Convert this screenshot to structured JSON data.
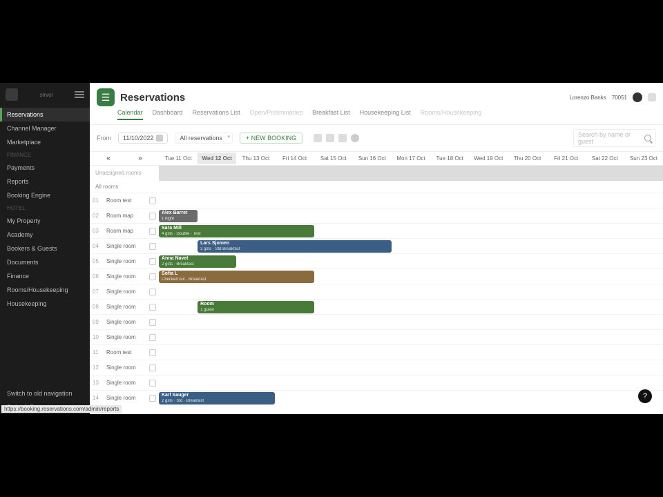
{
  "brand": "sirvoi",
  "sidebar": {
    "sections": [
      {
        "label": "",
        "items": [
          {
            "label": "Reservations",
            "active": true
          },
          {
            "label": "Channel Manager"
          },
          {
            "label": "Marketplace"
          }
        ]
      },
      {
        "label": "FINANCE",
        "items": [
          {
            "label": "Payments"
          },
          {
            "label": "Reports"
          },
          {
            "label": "Booking Engine"
          }
        ]
      },
      {
        "label": "HOTEL",
        "items": [
          {
            "label": "My Property"
          },
          {
            "label": "Academy"
          },
          {
            "label": "Bookers & Guests"
          },
          {
            "label": "Documents"
          },
          {
            "label": "Finance"
          },
          {
            "label": "Rooms/Housekeeping"
          },
          {
            "label": "Housekeeping"
          }
        ]
      }
    ],
    "footer": [
      {
        "label": "Switch to old navigation"
      },
      {
        "label": "Refer & Earn"
      }
    ]
  },
  "header": {
    "title": "Reservations",
    "account": "Lorenzo Banks",
    "account_id": "70051"
  },
  "tabs": [
    {
      "label": "Calendar",
      "active": true
    },
    {
      "label": "Dashboard"
    },
    {
      "label": "Reservations List"
    },
    {
      "label": "Open/Preliminaries",
      "muted": true
    },
    {
      "label": "Breakfast List"
    },
    {
      "label": "Housekeeping List"
    },
    {
      "label": "Rooms/Housekeeping",
      "muted": true
    }
  ],
  "toolbar": {
    "from_label": "From",
    "date": "11/10/2022",
    "filter": "All reservations",
    "new_btn": "+ NEW BOOKING",
    "search_placeholder": "Search by name or guest"
  },
  "calendar": {
    "dates": [
      "Tue 11 Oct",
      "Wed 12 Oct",
      "Thu 13 Oct",
      "Fri 14 Oct",
      "Sat 15 Oct",
      "Sun 16 Oct",
      "Mon 17 Oct",
      "Tue 18 Oct",
      "Wed 19 Oct",
      "Thu 20 Oct",
      "Fri 21 Oct",
      "Sat 22 Oct",
      "Sun 23 Oct"
    ],
    "today_index": 1,
    "unassigned_label": "Unassigned rooms",
    "allrooms_label": "All rooms",
    "rooms": [
      {
        "num": "01",
        "name": "Room test"
      },
      {
        "num": "02",
        "name": "Room map"
      },
      {
        "num": "03",
        "name": "Room map"
      },
      {
        "num": "04",
        "name": "Single room"
      },
      {
        "num": "05",
        "name": "Single room"
      },
      {
        "num": "06",
        "name": "Single room"
      },
      {
        "num": "07",
        "name": "Single room"
      },
      {
        "num": "08",
        "name": "Single room"
      },
      {
        "num": "09",
        "name": "Single room"
      },
      {
        "num": "10",
        "name": "Single room"
      },
      {
        "num": "11",
        "name": "Room test"
      },
      {
        "num": "12",
        "name": "Single room"
      },
      {
        "num": "13",
        "name": "Single room"
      },
      {
        "num": "14",
        "name": "Single room"
      }
    ],
    "bookings": [
      {
        "room": 1,
        "start": 0,
        "span": 1,
        "color": "c-grey",
        "title": "Alex Barret",
        "sub": "1 night"
      },
      {
        "room": 2,
        "start": 0,
        "span": 4,
        "color": "c-green",
        "title": "Sara Mill",
        "sub": "4 gsts · Double · Test"
      },
      {
        "room": 3,
        "start": 1,
        "span": 5,
        "color": "c-blue",
        "title": "Lars Sjomen",
        "sub": "2 gsts · Std Breakfast"
      },
      {
        "room": 4,
        "start": 0,
        "span": 2,
        "color": "c-green",
        "title": "Anna Navet",
        "sub": "2 gsts · Breakfast"
      },
      {
        "room": 5,
        "start": 0,
        "span": 4,
        "color": "c-brown",
        "title": "Sofia L",
        "sub": "Checked out · Breakfast"
      },
      {
        "room": 7,
        "start": 1,
        "span": 3,
        "color": "c-green",
        "title": "Room",
        "sub": "1 guest"
      },
      {
        "room": 13,
        "start": 0,
        "span": 3,
        "color": "c-blue",
        "title": "Karl Sauger",
        "sub": "2 gsts · Std · Breakfast"
      }
    ]
  },
  "status_url": "https://booking.reservations.com/admin/reports"
}
